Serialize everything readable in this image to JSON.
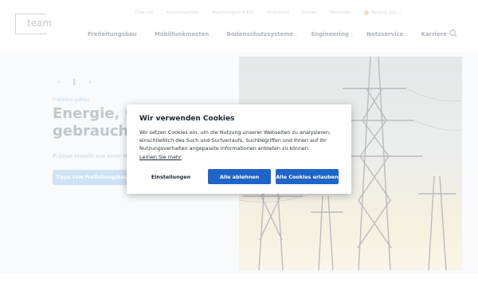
{
  "brand": {
    "logo_text": "team"
  },
  "topbar": {
    "links": [
      "Über uns",
      "Ansprechpartner",
      "Nachhaltigkeit & ESG",
      "Downloads",
      "Kontakt",
      "Newsroom"
    ],
    "language": "Deutsch (DE)",
    "lang_chevron": "⌄"
  },
  "nav": {
    "items": [
      {
        "label": "Freileitungsbau",
        "chevron": "⌄"
      },
      {
        "label": "Mobilfunkmasten",
        "chevron": "⌄"
      },
      {
        "label": "Bodenschutzsysteme",
        "chevron": "⌄"
      },
      {
        "label": "Engineering",
        "chevron": "⌄"
      },
      {
        "label": "Netzservice",
        "chevron": "⌄"
      },
      {
        "label": "Karriere",
        "chevron": ""
      }
    ]
  },
  "hero": {
    "prev_arrow": "‹",
    "pause": "‖",
    "next_arrow": "›",
    "kicker": "Freileitungsbau",
    "title": "Energie, wo sie gebraucht wird",
    "subtitle": "Präzise erstellt aus einer Hand",
    "cta": "Tipps zum Freileitungsbau"
  },
  "cookie_dialog": {
    "title": "Wir verwenden Cookies",
    "body": "Wir setzen Cookies ein, um die Nutzung unserer Webseiten zu analysieren, einschließlich des Such und Surfverlaufs, Suchbegriffen und Ihnen auf Ihr Nutzungsverhalten angepasste Informationen anbieten zu können.",
    "link": "Lernen Sie mehr",
    "btn_settings": "Einstellungen",
    "btn_reject": "Alle ablehnen",
    "btn_accept": "Alle Cookies erlauben"
  },
  "colors": {
    "primary_button": "#1f65c8",
    "title_text": "#1c2530"
  }
}
